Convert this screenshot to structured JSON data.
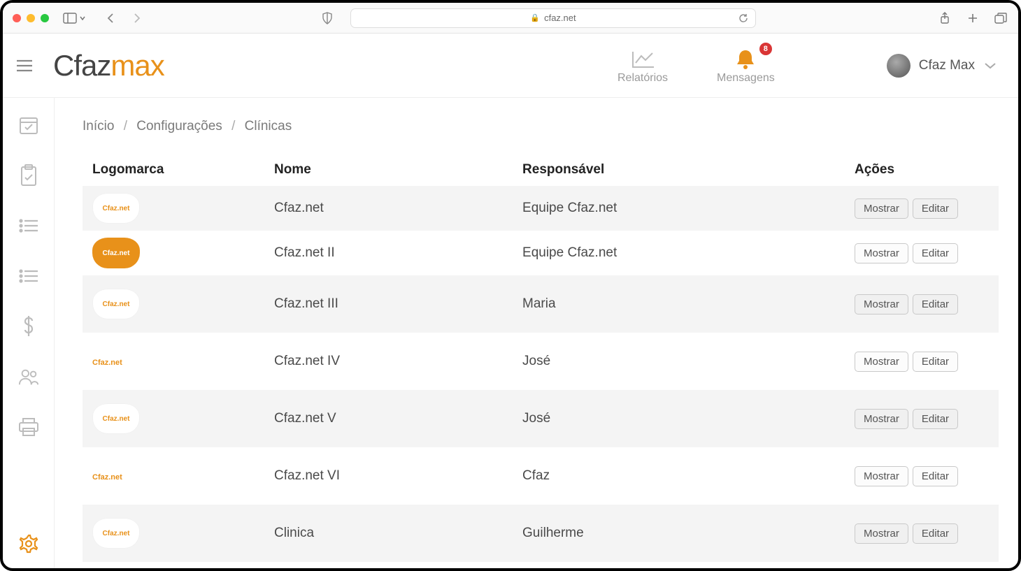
{
  "browser": {
    "url": "cfaz.net"
  },
  "header": {
    "logo_prefix": "Cfaz",
    "logo_suffix": "max",
    "nav": {
      "reports": "Relatórios",
      "messages": "Mensagens",
      "badge": "8"
    },
    "user": "Cfaz Max"
  },
  "breadcrumb": {
    "home": "Início",
    "settings": "Configurações",
    "current": "Clínicas"
  },
  "table": {
    "headers": {
      "logo": "Logomarca",
      "name": "Nome",
      "owner": "Responsável",
      "actions": "Ações"
    },
    "row_action_show": "Mostrar",
    "row_action_edit": "Editar",
    "rows": [
      {
        "logo_style": "white",
        "logo_text": "Cfaz.net",
        "name": "Cfaz.net",
        "owner": "Equipe Cfaz.net",
        "tall": false
      },
      {
        "logo_style": "orange",
        "logo_text": "Cfaz.net",
        "name": "Cfaz.net II",
        "owner": "Equipe Cfaz.net",
        "tall": false
      },
      {
        "logo_style": "white",
        "logo_text": "Cfaz.net",
        "name": "Cfaz.net III",
        "owner": "Maria",
        "tall": true
      },
      {
        "logo_style": "plain",
        "logo_text": "Cfaz.net",
        "name": "Cfaz.net IV",
        "owner": "José",
        "tall": true
      },
      {
        "logo_style": "white",
        "logo_text": "Cfaz.net",
        "name": "Cfaz.net V",
        "owner": "José",
        "tall": true
      },
      {
        "logo_style": "plain",
        "logo_text": "Cfaz.net",
        "name": "Cfaz.net VI",
        "owner": "Cfaz",
        "tall": true
      },
      {
        "logo_style": "white",
        "logo_text": "Cfaz.net",
        "name": "Clinica",
        "owner": "Guilherme",
        "tall": true
      }
    ]
  }
}
